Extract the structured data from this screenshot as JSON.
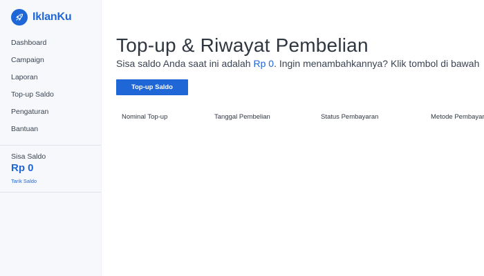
{
  "brand": {
    "name": "IklanKu"
  },
  "sidebar": {
    "items": [
      {
        "label": "Dashboard"
      },
      {
        "label": "Campaign"
      },
      {
        "label": "Laporan"
      },
      {
        "label": "Top-up Saldo"
      },
      {
        "label": "Pengaturan"
      },
      {
        "label": "Bantuan"
      }
    ],
    "balance": {
      "label": "Sisa Saldo",
      "value": "Rp 0",
      "link": "Tarik Saldo"
    }
  },
  "main": {
    "title": "Top-up & Riwayat Pembelian",
    "subtitle_before": "Sisa saldo Anda saat ini adalah ",
    "subtitle_amount": "Rp 0",
    "subtitle_after": ". Ingin menambahkannya? Klik tombol di bawah",
    "button_label": "Top-up Saldo",
    "table": {
      "columns": [
        "Nominal Top-up",
        "Tanggal Pembelian",
        "Status Pembayaran",
        "Metode Pembayaran"
      ]
    }
  },
  "colors": {
    "accent": "#1f66d6",
    "sidebar_bg": "#f6f8fb",
    "text": "#2f3640"
  },
  "icons": {
    "logo": "rocket-icon"
  }
}
